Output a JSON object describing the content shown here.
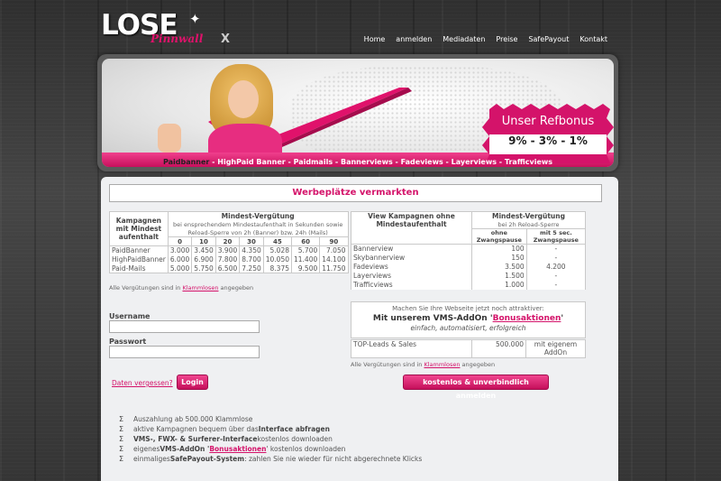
{
  "header": {
    "logo_main": "LOSE",
    "logo_sub": "Pinnwall",
    "logo_x": "X",
    "nav": [
      "Home",
      "anmelden",
      "Mediadaten",
      "Preise",
      "SafePayout",
      "Kontakt"
    ]
  },
  "banner": {
    "refbonus_title": "Unser Refbonus",
    "refbonus_values": "9% - 3% - 1%",
    "tabs": [
      "Paidbanner",
      "HighPaid Banner",
      "Paidmails",
      "Bannerviews",
      "Fadeviews",
      "Layerviews",
      "Trafficviews"
    ],
    "tab_separator": " - ",
    "active_tab": "Paidbanner",
    "colors": {
      "pink": "#e0126b",
      "dark_pink": "#c70f5c"
    }
  },
  "main": {
    "headline": "Werbeplätze vermarkten",
    "table1": {
      "col1_header": "Kampagnen mit Mindest aufenthalt",
      "col2_header": "Mindest-Vergütung",
      "col2_sub": "bei ensprechendem Mindestaufenthalt in Sekunden sowie Reload-Sperre von 2h (Banner) bzw. 24h (Mails)",
      "seconds": [
        "0",
        "10",
        "20",
        "30",
        "45",
        "60",
        "90"
      ],
      "rows": [
        {
          "name": "PaidBanner",
          "values": [
            "3.000",
            "3.450",
            "3.900",
            "4.350",
            "5.028",
            "5.700",
            "7.050"
          ]
        },
        {
          "name": "HighPaidBanner",
          "values": [
            "6.000",
            "6.900",
            "7.800",
            "8.700",
            "10.050",
            "11.400",
            "14.100"
          ]
        },
        {
          "name": "Paid-Mails",
          "values": [
            "5.000",
            "5.750",
            "6.500",
            "7.250",
            "8.375",
            "9.500",
            "11.750"
          ]
        }
      ]
    },
    "note1_prefix": "Alle Vergütungen sind in ",
    "note1_link": "Klammlosen",
    "note1_suffix": " angegeben",
    "table2": {
      "col1_header": "View Kampagnen ohne Mindestaufenthalt",
      "col2_header": "Mindest-Vergütung",
      "col2_sub": "bei 2h Reload-Sperre",
      "sub1": "ohne Zwangspause",
      "sub2": "mit 5 sec. Zwangspause",
      "rows": [
        {
          "name": "Bannerview",
          "v1": "100",
          "v2": "-"
        },
        {
          "name": "Skybannerview",
          "v1": "150",
          "v2": "-"
        },
        {
          "name": "Fadeviews",
          "v1": "3.500",
          "v2": "4.200"
        },
        {
          "name": "Layerviews",
          "v1": "1.500",
          "v2": "-"
        },
        {
          "name": "Trafficviews",
          "v1": "1.000",
          "v2": "-"
        }
      ]
    },
    "promo": {
      "line1": "Machen Sie Ihre Webseite jetzt noch attraktiver:",
      "line2_prefix": "Mit unserem VMS-AddOn '",
      "line2_link": "Bonusaktionen",
      "line2_suffix": "'",
      "line3": "einfach, automatisiert, erfolgreich"
    },
    "table3": {
      "name": "TOP-Leads & Sales",
      "v1": "500.000",
      "v2": "mit eigenem AddOn"
    },
    "note2_prefix": "Alle Vergütungen sind in ",
    "note2_link": "Klammlosen",
    "note2_suffix": " angegeben",
    "login": {
      "username_label": "Username",
      "password_label": "Passwort",
      "forgot": "Daten vergessen?",
      "login_button": "Login"
    },
    "register_button": "kostenlos & unverbindlich anmelden",
    "features": [
      {
        "pre": "Auszahlung ab 500.000 Klammlose",
        "bold": "",
        "link": "",
        "post": ""
      },
      {
        "pre": "aktive Kampagnen bequem über das ",
        "bold": "Interface abfragen",
        "link": "",
        "post": ""
      },
      {
        "pre": "",
        "bold": "VMS-, FWX- & Surferer-Interface",
        "link": "",
        "post": " kostenlos downloaden"
      },
      {
        "pre": "eigenes ",
        "bold": "VMS-AddOn '",
        "link": "Bonusaktionen",
        "post": "' kostenlos downloaden"
      },
      {
        "pre": "einmaliges ",
        "bold": "SafePayout-System",
        "link": "",
        "post": ": zahlen Sie nie wieder für nicht abgerechnete Klicks"
      }
    ],
    "feature_icon": "Σ"
  }
}
